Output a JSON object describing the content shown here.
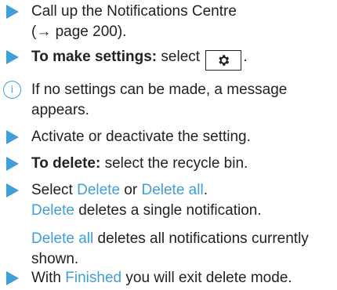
{
  "colors": {
    "accent": "#3f9fd9",
    "text": "#222222"
  },
  "steps": [
    {
      "marker": "triangle",
      "line1": "Call up the Notifications Centre",
      "line2": "(→ page 200)."
    },
    {
      "marker": "triangle",
      "bold": "To make settings:",
      "text": " select ",
      "icon": "gear-icon",
      "suffix": "."
    },
    {
      "marker": "info",
      "line1": "If no settings can be made, a message",
      "line2": "appears."
    },
    {
      "marker": "triangle",
      "text": "Activate or deactivate the setting."
    },
    {
      "marker": "triangle",
      "bold": "To delete:",
      "text": " select the recycle bin."
    },
    {
      "marker": "triangle",
      "pre": "Select ",
      "link1": "Delete",
      "mid": " or ",
      "link2": "Delete all",
      "end": ".",
      "l2_link": "Delete",
      "l2_text": " deletes a single notification.",
      "p2_link": "Delete all",
      "p2_text1": " deletes all notifications currently",
      "p2_text2": "shown."
    },
    {
      "marker": "triangle",
      "pre": "With ",
      "link": "Finished",
      "post": " you will exit delete mode."
    }
  ]
}
